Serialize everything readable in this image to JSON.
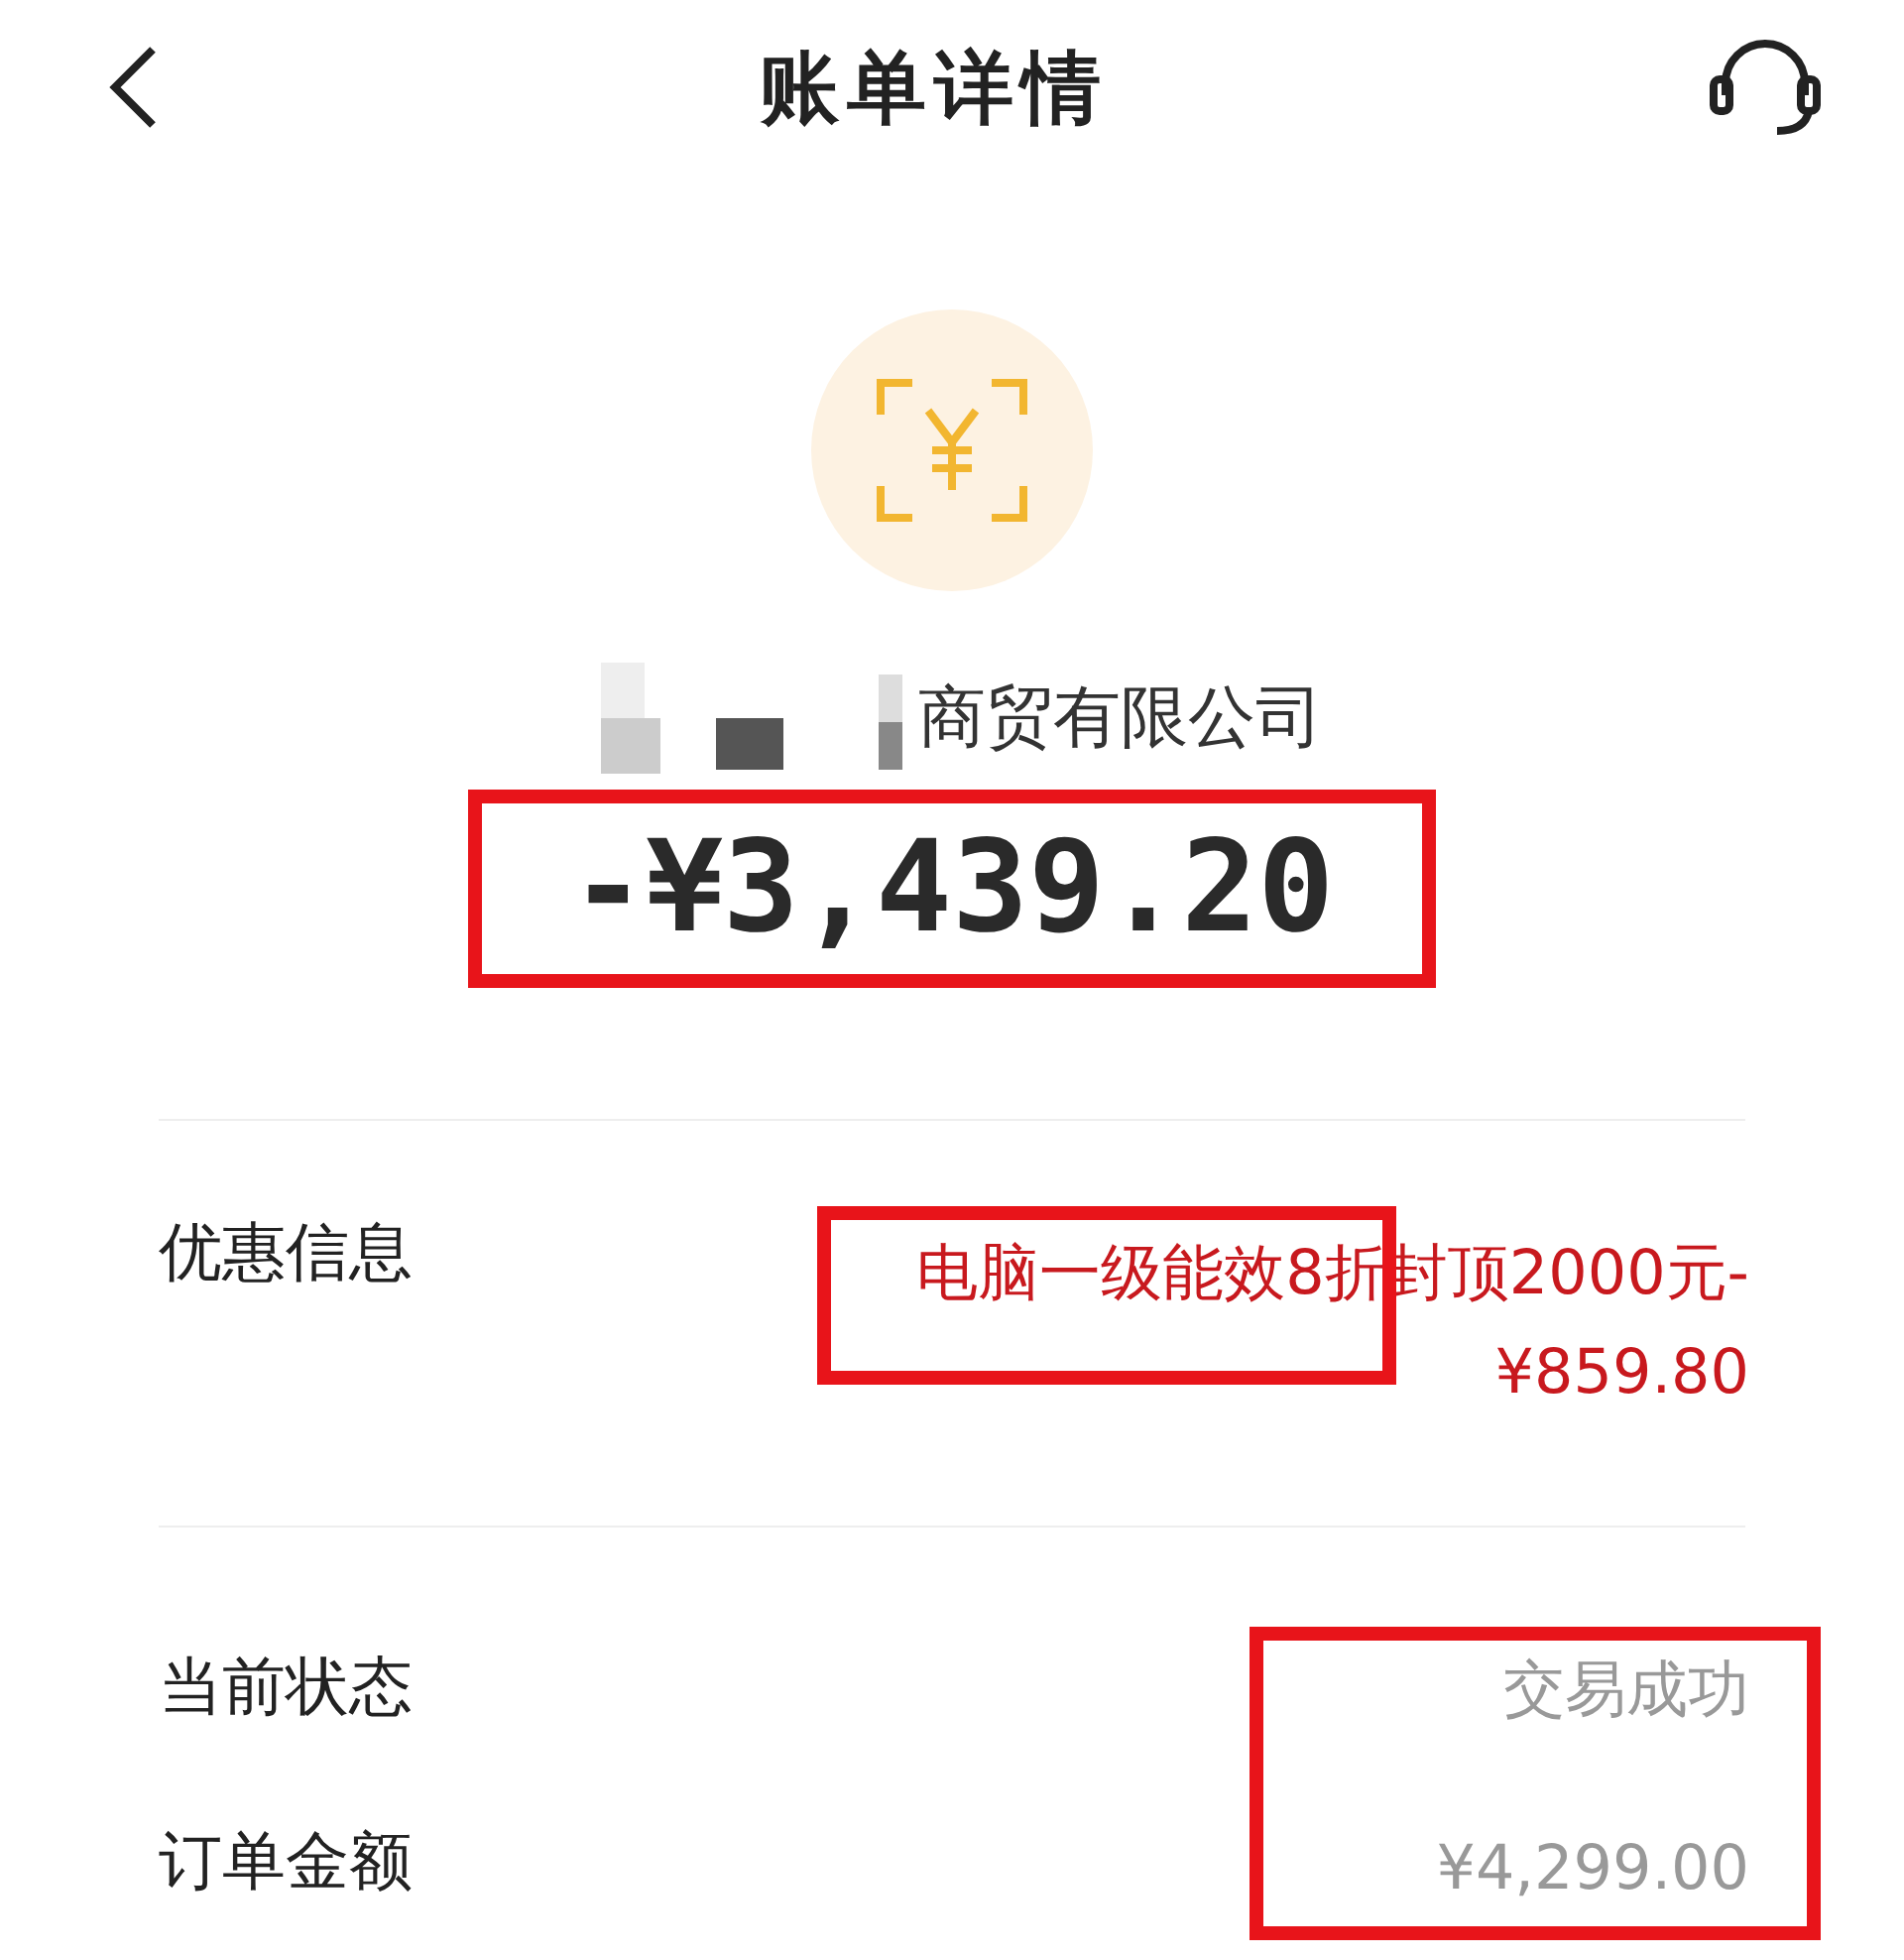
{
  "header": {
    "title": "账单详情"
  },
  "merchant": {
    "name": "商贸有限公司",
    "redacted": true
  },
  "amount": "-¥3,439.20",
  "details": [
    {
      "label": "优惠信息",
      "value_lines": [
        "电脑一级能效8折封顶2000元-",
        "¥859.80"
      ],
      "kind": "discount"
    },
    {
      "label": "当前状态",
      "value_lines": [
        "交易成功"
      ],
      "kind": "plain"
    },
    {
      "label": "订单金额",
      "value_lines": [
        "¥4,299.00"
      ],
      "kind": "plain"
    }
  ]
}
